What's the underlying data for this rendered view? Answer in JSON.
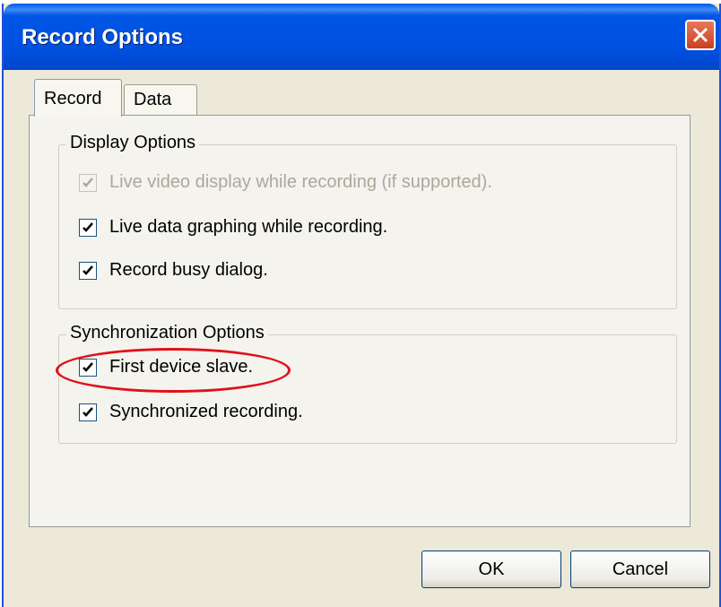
{
  "window": {
    "title": "Record Options"
  },
  "tabs": [
    {
      "label": "Record",
      "selected": true
    },
    {
      "label": "Data",
      "selected": false
    }
  ],
  "display_options": {
    "legend": "Display Options",
    "items": [
      {
        "label": "Live video display while recording (if supported).",
        "checked": true,
        "enabled": false
      },
      {
        "label": "Live data graphing while recording.",
        "checked": true,
        "enabled": true
      },
      {
        "label": "Record busy dialog.",
        "checked": true,
        "enabled": true
      }
    ]
  },
  "sync_options": {
    "legend": "Synchronization Options",
    "items": [
      {
        "label": "First device slave.",
        "checked": true,
        "enabled": true,
        "highlighted": true
      },
      {
        "label": "Synchronized recording.",
        "checked": true,
        "enabled": true
      }
    ]
  },
  "buttons": {
    "ok": "OK",
    "cancel": "Cancel"
  },
  "colors": {
    "titlebar": "#0054e3",
    "highlight": "#e0101a",
    "dialog_bg": "#ece9d8"
  },
  "icons": {
    "close": "close-icon",
    "check": "checkmark-icon"
  }
}
